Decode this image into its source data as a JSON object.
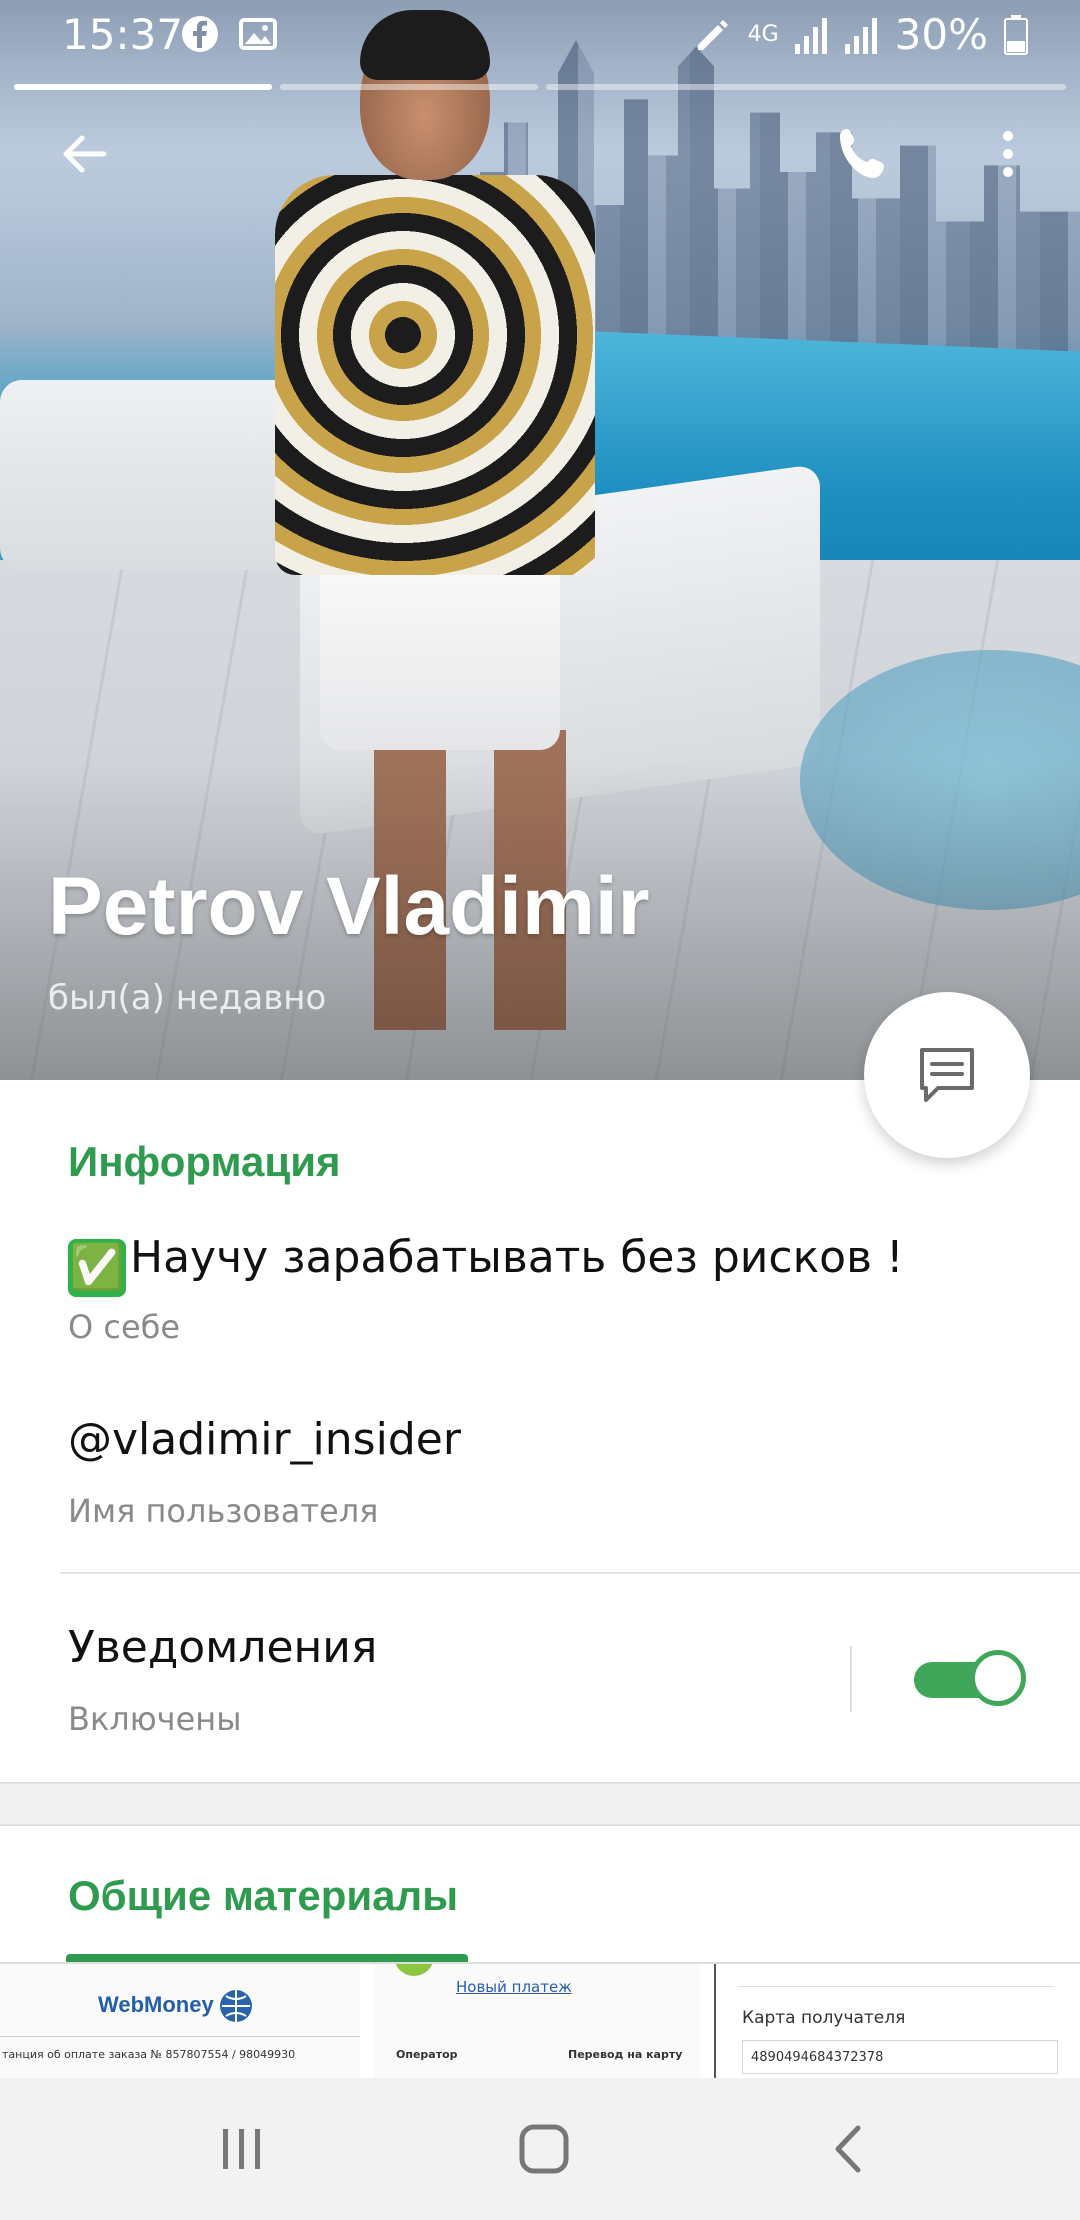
{
  "status_bar": {
    "time": "15:37",
    "network": "4G",
    "battery": "30%",
    "icons": [
      "facebook-icon",
      "gallery-icon",
      "edit-icon",
      "signal-icon",
      "signal-icon",
      "battery-icon"
    ]
  },
  "story_progress": [
    1.0,
    0.0,
    0.0
  ],
  "profile": {
    "name": "Petrov Vladimir",
    "status": "был(а) недавно"
  },
  "info": {
    "section_title": "Информация",
    "bio_emoji": "✅",
    "bio": "Научу зарабатывать без рисков !",
    "bio_label": "О себе",
    "username": "@vladimir_insider",
    "username_label": "Имя пользователя",
    "notifications": "Уведомления",
    "notifications_state": "Включены",
    "notifications_enabled": true
  },
  "media": {
    "section_title": "Общие материалы",
    "thumb1": {
      "logo": "WebMoney",
      "text": "танция об оплате заказа № 857807554 / 98049930"
    },
    "thumb2": {
      "link": "Новый платеж",
      "col1": "Оператор",
      "col2": "Перевод на карту"
    },
    "thumb3": {
      "label": "Карта получателя",
      "value": "4890494684372378"
    }
  },
  "colors": {
    "accent": "#2e9b4e",
    "toggle": "#40a75a"
  }
}
